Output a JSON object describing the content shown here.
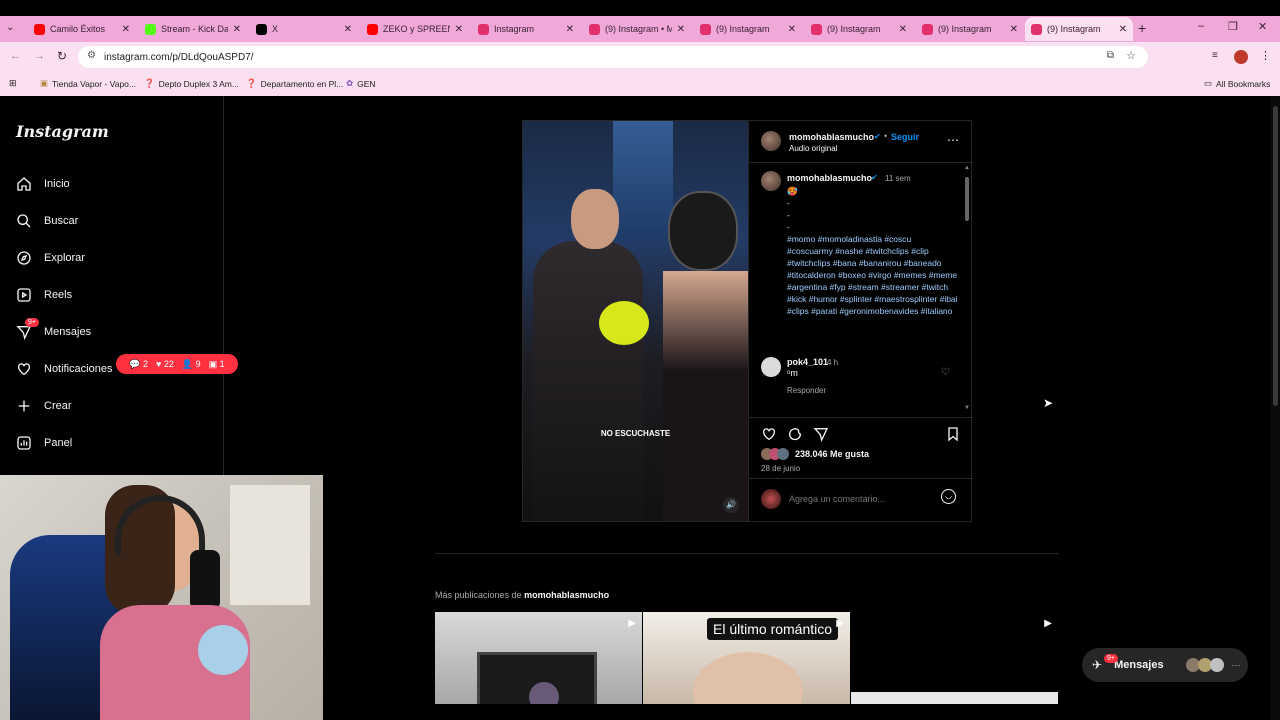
{
  "browser": {
    "tabs": [
      {
        "title": "Camilo Éxitos",
        "favcolor": "#ff0000"
      },
      {
        "title": "Stream - Kick Dash",
        "favcolor": "#53fc18"
      },
      {
        "title": "X",
        "favcolor": "#000000"
      },
      {
        "title": "ZEKO y SPREEN h",
        "favcolor": "#ff0000"
      },
      {
        "title": "Instagram",
        "favcolor": "#e1306c"
      },
      {
        "title": "(9) Instagram • M",
        "favcolor": "#e1306c"
      },
      {
        "title": "(9) Instagram",
        "favcolor": "#e1306c"
      },
      {
        "title": "(9) Instagram",
        "favcolor": "#e1306c"
      },
      {
        "title": "(9) Instagram",
        "favcolor": "#e1306c"
      },
      {
        "title": "(9) Instagram",
        "favcolor": "#e1306c"
      }
    ],
    "url": "instagram.com/p/DLdQouASPD7/",
    "bookmarks": [
      "Tienda Vapor - Vapo...",
      "Depto Duplex 3 Am...",
      "Departamento en Pl...",
      "GEN"
    ],
    "all_bookmarks": "All Bookmarks"
  },
  "sidebar": {
    "logo": "Instagram",
    "items": [
      {
        "label": "Inicio",
        "icon": "home-icon"
      },
      {
        "label": "Buscar",
        "icon": "search-icon"
      },
      {
        "label": "Explorar",
        "icon": "compass-icon"
      },
      {
        "label": "Reels",
        "icon": "reels-icon"
      },
      {
        "label": "Mensajes",
        "icon": "messenger-icon",
        "badge": "9+"
      },
      {
        "label": "Notificaciones",
        "icon": "heart-icon"
      },
      {
        "label": "Crear",
        "icon": "plus-icon"
      },
      {
        "label": "Panel",
        "icon": "chart-icon"
      }
    ],
    "notifications": {
      "comments": "2",
      "likes": "22",
      "follows": "9",
      "other": "1"
    }
  },
  "post": {
    "video_caption": "NO ESCUCHASTE",
    "header_user": "momohablasmucho",
    "follow": "Seguir",
    "audio": "Audio original",
    "caption_user": "momohablasmucho",
    "caption_time": "11 sem",
    "caption_emoji": "🥵",
    "caption_dashes": [
      "-",
      "-",
      "-"
    ],
    "hashtags": "#momo #momoladinastia #coscu #coscuarmy #nashe #twitchclips #clip #twitchclips #bana #bananirou #baneado #titocalderon #boxeo #virgo #memes #meme #argentina #fyp #stream #streamer #twitch #kick #humor #splinter #maestrosplinter #ibai #clips #parati #geronimobenavides #italiano",
    "comment_user": "pok4_101",
    "comment_time": "4 h",
    "comment_text": "ᵒm",
    "reply": "Responder",
    "likes": "238.046 Me gusta",
    "date": "28 de junio",
    "add_comment_placeholder": "Agrega un comentario..."
  },
  "more": {
    "prefix": "Más publicaciones de",
    "user": "momohablasmucho",
    "thumb2_text": "El último romántico"
  },
  "messages_float": {
    "label": "Mensajes",
    "badge": "9+"
  }
}
